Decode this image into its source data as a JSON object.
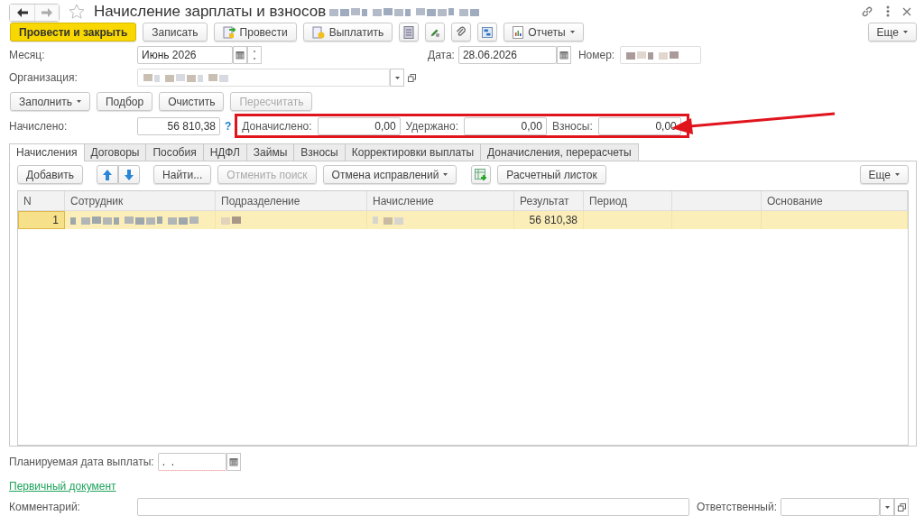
{
  "window": {
    "title": "Начисление зарплаты и взносов",
    "title_blurred": true,
    "favorite": false
  },
  "nav": [
    {
      "kind": "back",
      "disabled": false
    },
    {
      "kind": "forward",
      "disabled": true
    }
  ],
  "toolbar": {
    "buttons": [
      {
        "kind": "primary",
        "label": "Провести и закрыть"
      },
      {
        "kind": "plain",
        "label": "Записать"
      },
      {
        "kind": "post",
        "label": "Провести"
      },
      {
        "kind": "pay",
        "label": "Выплатить"
      },
      {
        "kind": "list"
      },
      {
        "kind": "edit"
      },
      {
        "kind": "attach"
      },
      {
        "kind": "structure"
      },
      {
        "kind": "reports",
        "label": "Отчеты"
      }
    ],
    "more": "Еще"
  },
  "month": {
    "label": "Месяц:",
    "value": "Июнь 2026"
  },
  "date": {
    "label": "Дата:",
    "value": "28.06.2026"
  },
  "number": {
    "label": "Номер:",
    "blurred": true
  },
  "organization": {
    "label": "Организация:",
    "blurred": true
  },
  "actions": [
    {
      "label": "Заполнить",
      "dropdown": true,
      "disabled": false
    },
    {
      "label": "Подбор",
      "dropdown": false,
      "disabled": false
    },
    {
      "label": "Очистить",
      "dropdown": false,
      "disabled": false
    },
    {
      "label": "Пересчитать",
      "dropdown": false,
      "disabled": true
    }
  ],
  "accrued": {
    "label": "Начислено:",
    "value": "56 810,38",
    "help": "?"
  },
  "totals": {
    "highlighted": true,
    "arrow": true,
    "items": [
      {
        "label": "Доначислено:",
        "value": "0,00"
      },
      {
        "label": "Удержано:",
        "value": "0,00"
      },
      {
        "label": "Взносы:",
        "value": "0,00"
      }
    ]
  },
  "tabs": [
    {
      "label": "Начисления",
      "selected": true
    },
    {
      "label": "Договоры",
      "selected": false
    },
    {
      "label": "Пособия",
      "selected": false
    },
    {
      "label": "НДФЛ",
      "selected": false
    },
    {
      "label": "Займы",
      "selected": false
    },
    {
      "label": "Взносы",
      "selected": false
    },
    {
      "label": "Корректировки выплаты",
      "selected": false
    },
    {
      "label": "Доначисления, перерасчеты",
      "selected": false
    }
  ],
  "tab_toolbar": {
    "buttons": [
      {
        "kind": "plain",
        "label": "Добавить",
        "disabled": false
      },
      {
        "kind": "up",
        "disabled": false
      },
      {
        "kind": "down",
        "disabled": false
      },
      {
        "kind": "plain",
        "label": "Найти...",
        "disabled": false
      },
      {
        "kind": "plain",
        "label": "Отменить поиск",
        "disabled": true
      },
      {
        "kind": "menu",
        "label": "Отмена исправлений",
        "disabled": false
      },
      {
        "kind": "addrow",
        "disabled": false
      },
      {
        "kind": "plain",
        "label": "Расчетный листок",
        "disabled": false
      }
    ],
    "more": "Еще"
  },
  "table": {
    "columns": [
      {
        "label": "N"
      },
      {
        "label": "Сотрудник"
      },
      {
        "label": "Подразделение"
      },
      {
        "label": "Начисление"
      },
      {
        "label": "Результат"
      },
      {
        "label": "Период"
      },
      {},
      {
        "label": "Основание"
      }
    ],
    "rows": [
      {
        "selected": true,
        "n": "1",
        "employee_blurred": true,
        "department_blurred": true,
        "accrual_blurred": true,
        "result": "56 810,38"
      }
    ]
  },
  "payment_date": {
    "label": "Планируемая дата выплаты:",
    "value": ".  .",
    "required": true
  },
  "primary_document": "Первичный документ",
  "comment": {
    "label": "Комментарий:"
  },
  "responsible": {
    "label": "Ответственный:"
  }
}
